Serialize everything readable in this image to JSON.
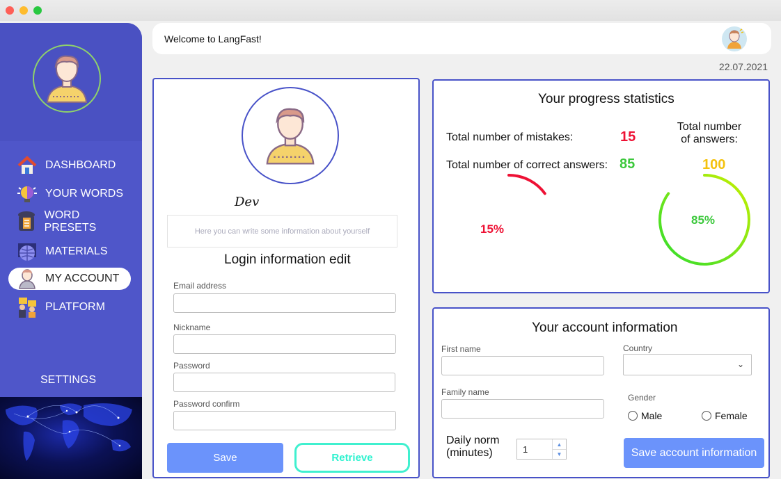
{
  "app": {
    "welcome": "Welcome to LangFast!",
    "date": "22.07.2021"
  },
  "sidebar": {
    "items": [
      {
        "label": "DASHBOARD",
        "icon": "home-icon"
      },
      {
        "label": "YOUR WORDS",
        "icon": "bulb-icon"
      },
      {
        "label": "WORD PRESETS",
        "icon": "presets-icon"
      },
      {
        "label": "MATERIALS",
        "icon": "globe-book-icon"
      },
      {
        "label": "MY ACCOUNT",
        "icon": "user-icon",
        "active": true
      },
      {
        "label": "PLATFORM",
        "icon": "platform-icon"
      }
    ],
    "settings": "SETTINGS"
  },
  "profile": {
    "username": "Dev",
    "about_placeholder": "Here you can write some information about yourself"
  },
  "login_edit": {
    "title": "Login information edit",
    "email_label": "Email address",
    "nickname_label": "Nickname",
    "password_label": "Password",
    "password_confirm_label": "Password confirm",
    "save_label": "Save",
    "retrieve_label": "Retrieve"
  },
  "stats": {
    "title": "Your progress statistics",
    "mistakes_label": "Total number of mistakes:",
    "mistakes_value": "15",
    "correct_label": "Total number of correct answers:",
    "correct_value": "85",
    "answers_label_line1": "Total number",
    "answers_label_line2": "of answers:",
    "answers_value": "100",
    "mistakes_pct_text": "15%",
    "correct_pct_text": "85%",
    "mistakes_fraction": 0.15,
    "correct_fraction": 0.85,
    "colors": {
      "mistakes": "#ee1134",
      "correct": "#3cc83c",
      "total": "#f4c20d"
    }
  },
  "account": {
    "title": "Your account information",
    "first_name_label": "First name",
    "family_name_label": "Family name",
    "country_label": "Country",
    "gender_label": "Gender",
    "male_label": "Male",
    "female_label": "Female",
    "daily_norm_line1": "Daily norm",
    "daily_norm_line2": "(minutes)",
    "daily_norm_value": "1",
    "save_label": "Save account information"
  }
}
